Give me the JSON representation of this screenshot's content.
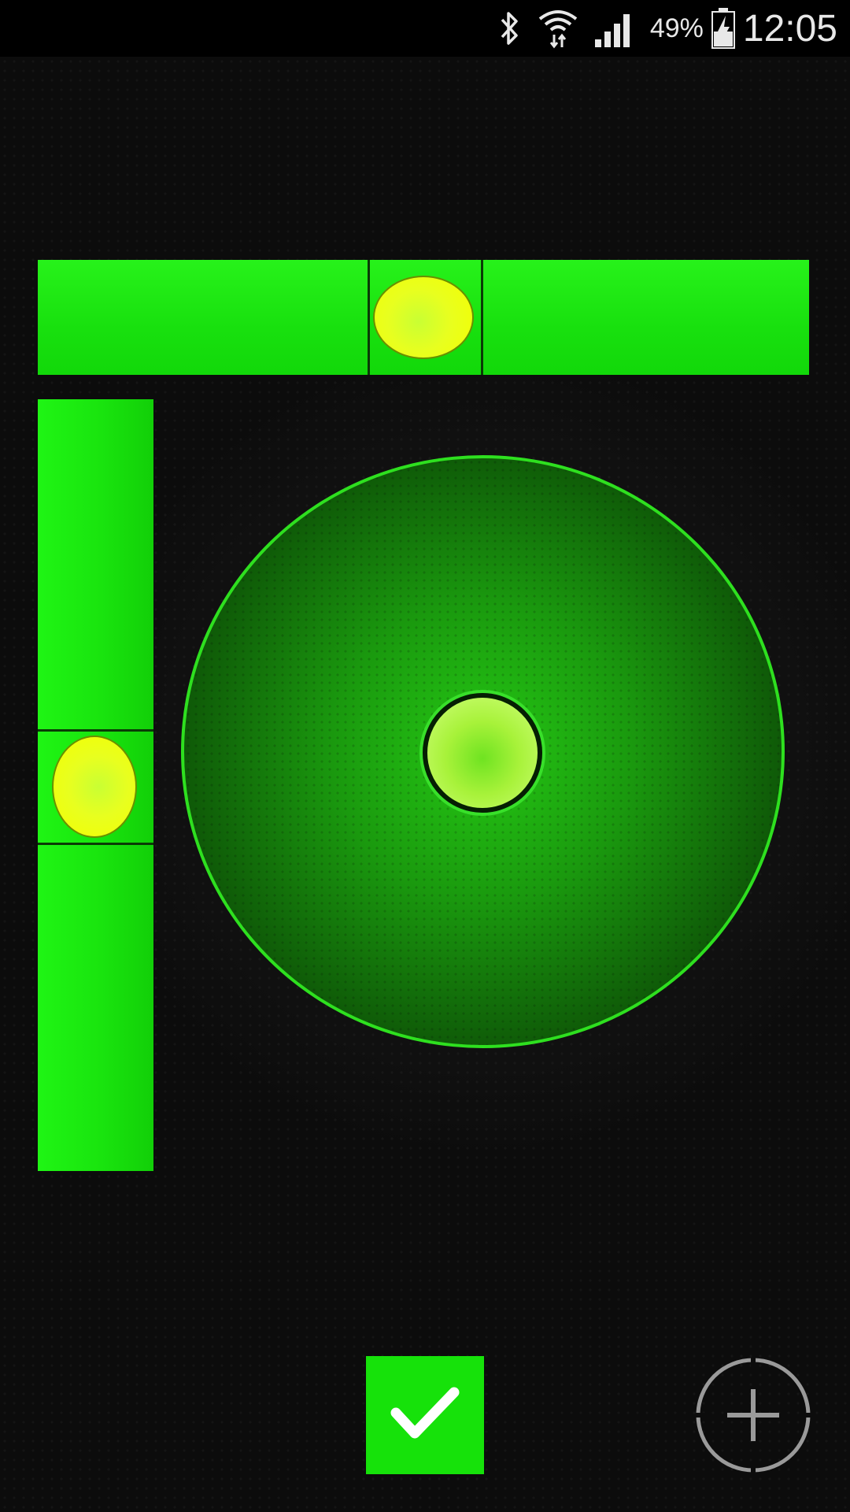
{
  "status_bar": {
    "icons": [
      "bluetooth-icon",
      "wifi-icon",
      "signal-icon",
      "battery-charging-icon"
    ],
    "battery_percent": "49%",
    "time": "12:05"
  },
  "levels": {
    "horizontal": {
      "bubble_color": "#f0ff10"
    },
    "vertical": {
      "bubble_color": "#f0ff10"
    },
    "bullseye": {
      "ring_color": "#2ee01f",
      "bubble_color": "#b6f548"
    }
  },
  "controls": {
    "confirm_icon": "check-icon",
    "calibrate_icon": "crosshair-plus-icon"
  },
  "colors": {
    "accent_green": "#16e20a",
    "background": "#0c0c0c"
  }
}
